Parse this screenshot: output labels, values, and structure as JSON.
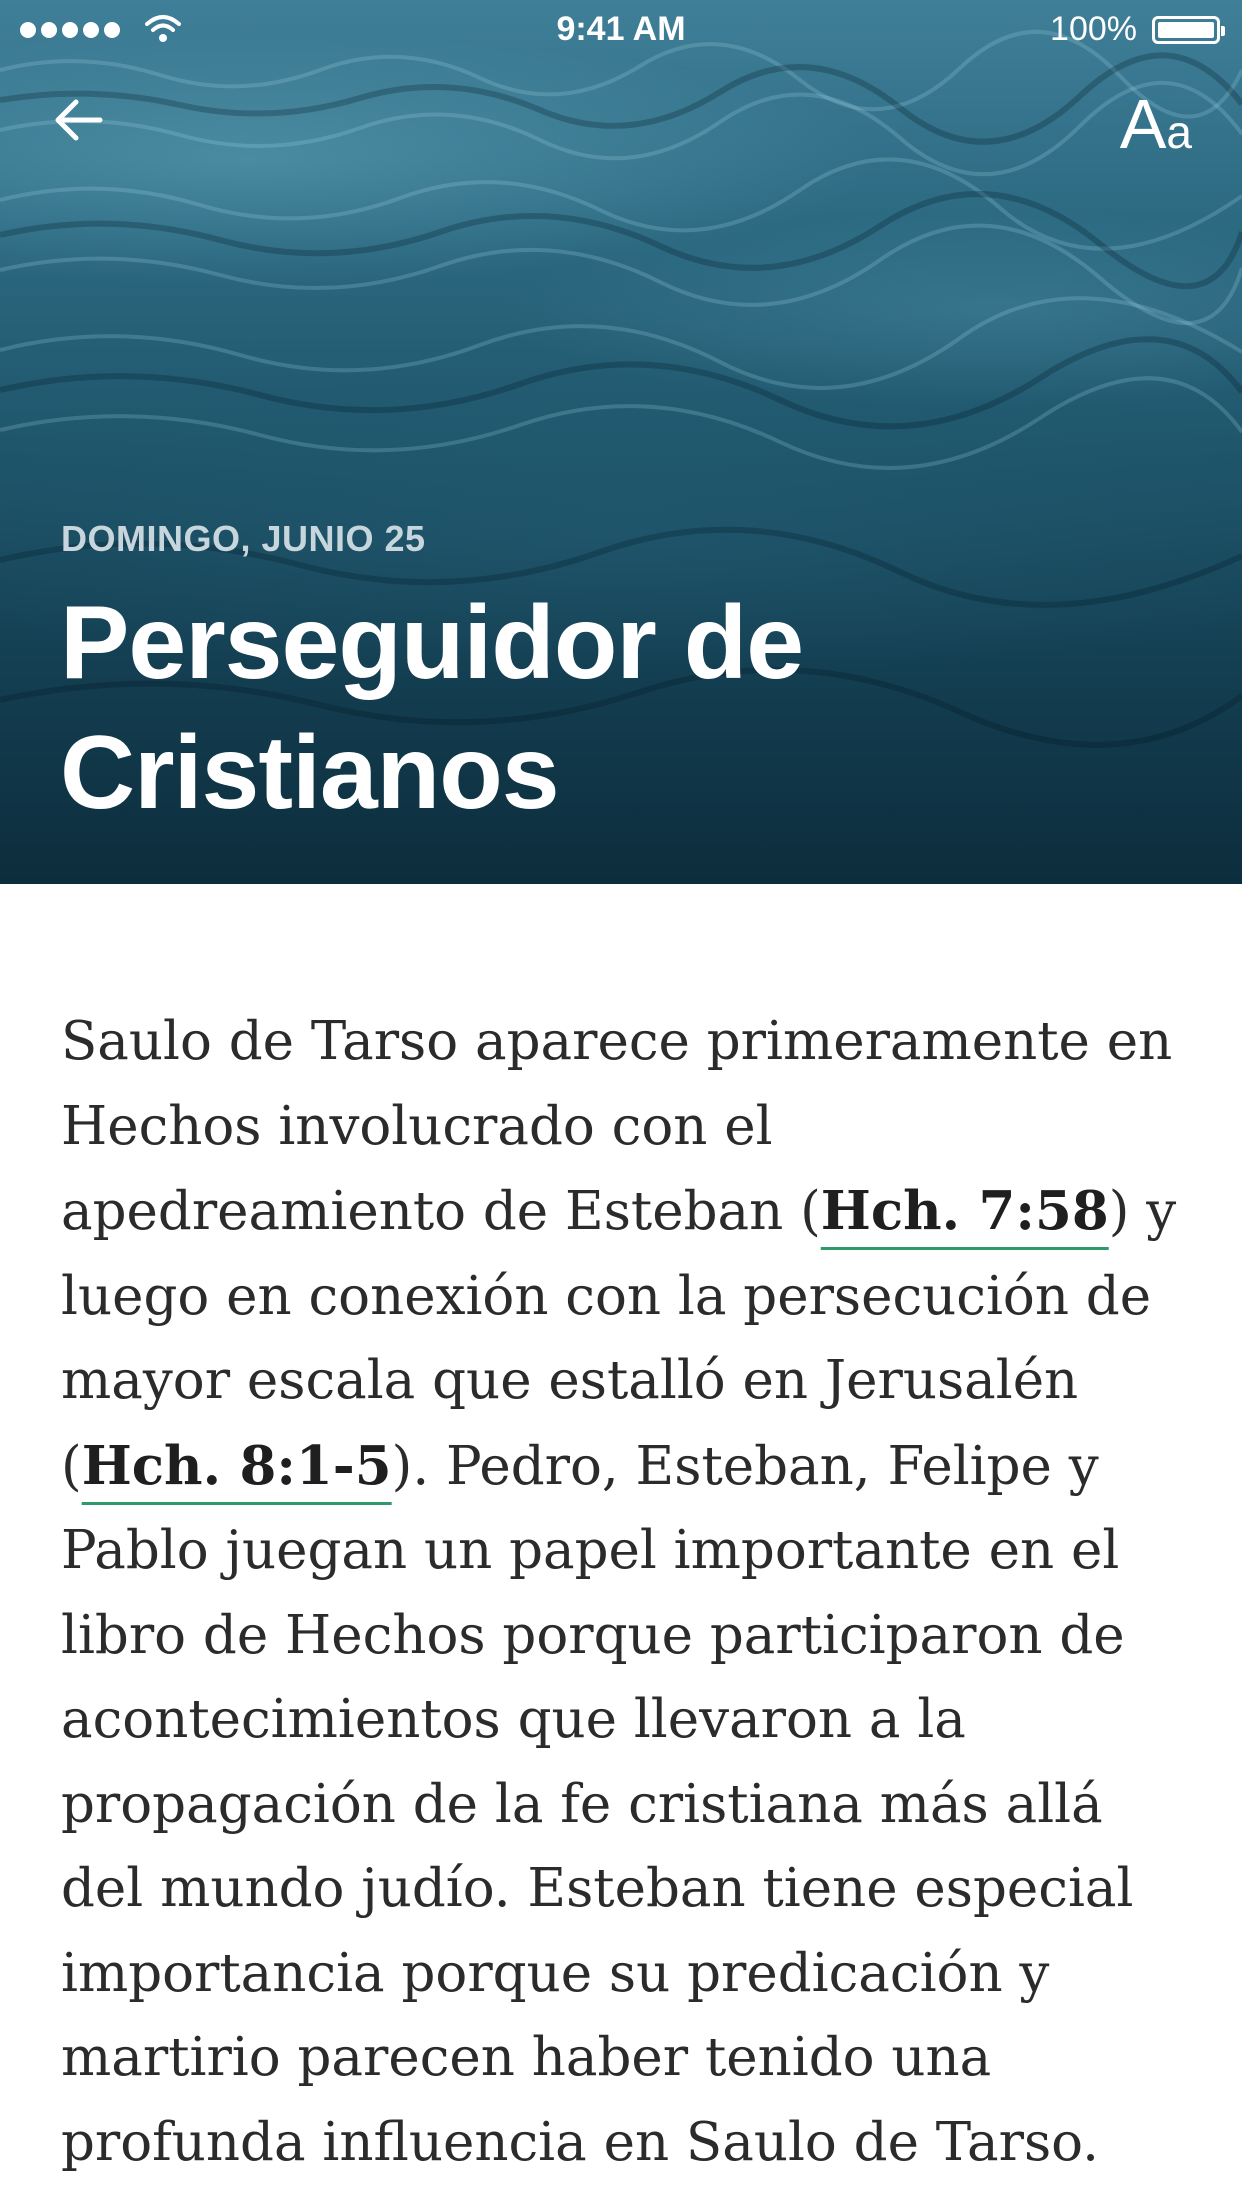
{
  "status_bar": {
    "time": "9:41 AM",
    "battery": "100%"
  },
  "header": {
    "date": "DOMINGO, JUNIO 25",
    "title_line1": "Perseguidor de",
    "title_line2": "Cristianos",
    "font_button_big": "A",
    "font_button_small": "a"
  },
  "body": {
    "p1": "Saulo de Tarso aparece primeramente en Hechos involucrado con el apedreamiento de Esteban (",
    "ref1": "Hch. 7:58",
    "p2": ") y luego en conexión con la persecución de mayor escala que estalló en Jerusalén (",
    "ref2": "Hch. 8:1-5",
    "p3": "). Pedro, Esteban, Felipe y Pablo juegan un papel importante en el libro de Hechos porque participaron de acontecimientos que llevaron a la propagación de la fe cristiana más allá del mundo judío. Esteban tiene especial importancia porque su predicación y martirio parecen haber tenido una profunda influencia en Saulo de Tarso."
  },
  "colors": {
    "link_underline": "#2e9a6a",
    "hero_dark": "#0c2d3c"
  }
}
